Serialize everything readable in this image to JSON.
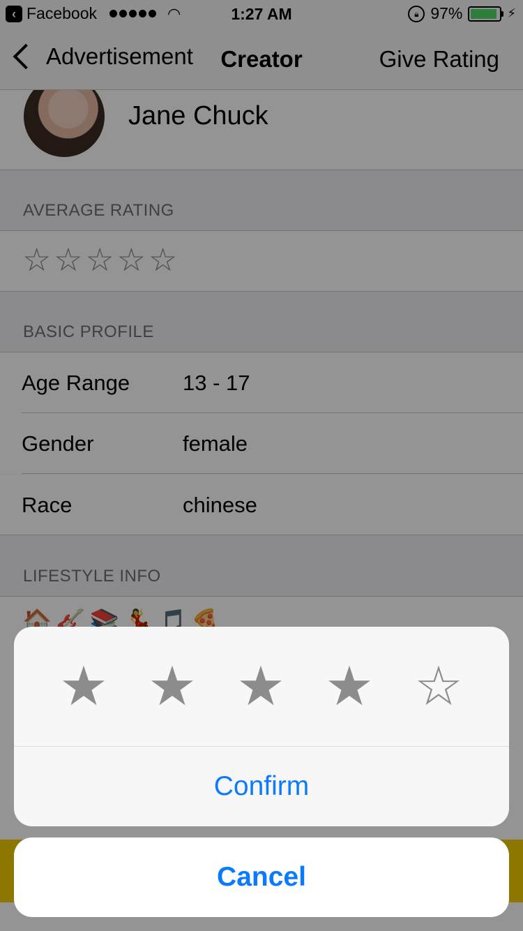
{
  "status_bar": {
    "app_back": "Facebook",
    "time": "1:27 AM",
    "battery": "97%",
    "battery_level": 0.97
  },
  "nav": {
    "back_label": "Advertisement",
    "title": "Creator",
    "right_label": "Give Rating"
  },
  "profile": {
    "name": "Jane Chuck"
  },
  "sections": {
    "average_rating": "AVERAGE RATING",
    "basic_profile": "BASIC PROFILE",
    "lifestyle_info": "LIFESTYLE INFO"
  },
  "average_rating": {
    "value": 0,
    "max": 5,
    "stars": [
      "☆",
      "☆",
      "☆",
      "☆",
      "☆"
    ]
  },
  "basic_profile": [
    {
      "label": "Age Range",
      "value": "13 - 17"
    },
    {
      "label": "Gender",
      "value": "female"
    },
    {
      "label": "Race",
      "value": "chinese"
    }
  ],
  "lifestyle": {
    "emojis": "🏠🎸📚💃🎵🍕"
  },
  "rating_sheet": {
    "selected": 4,
    "max": 5,
    "stars": [
      "★",
      "★",
      "★",
      "★",
      "☆"
    ],
    "confirm_label": "Confirm",
    "cancel_label": "Cancel"
  },
  "colors": {
    "accent": "#0a7aff",
    "highlight_bar": "#f5cd00",
    "battery": "#4cd964"
  }
}
